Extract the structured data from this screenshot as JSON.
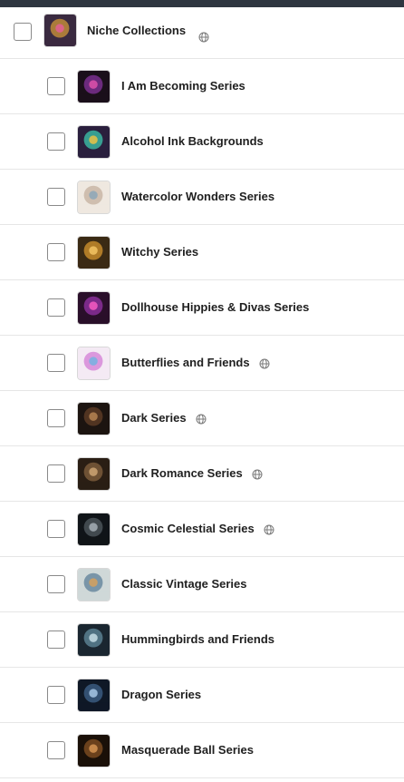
{
  "parent": {
    "label": "Niche Collections",
    "icon": "globe-icon"
  },
  "items": [
    {
      "label": "I Am Becoming Series",
      "globe": false,
      "thumb_colors": [
        "#1a0f1a",
        "#7a2f8f",
        "#d84fa8"
      ]
    },
    {
      "label": "Alcohol Ink Backgrounds",
      "globe": false,
      "thumb_colors": [
        "#2a1f3d",
        "#3bb5a0",
        "#e0c04a"
      ]
    },
    {
      "label": "Watercolor Wonders Series",
      "globe": false,
      "thumb_colors": [
        "#efe8e0",
        "#c9b6a6",
        "#8fa7b8"
      ]
    },
    {
      "label": "Witchy Series",
      "globe": false,
      "thumb_colors": [
        "#3a2a14",
        "#c48a2a",
        "#f0c060"
      ]
    },
    {
      "label": "Dollhouse Hippies & Divas Series",
      "globe": false,
      "thumb_colors": [
        "#2a0f2a",
        "#8a2f9a",
        "#f058c0"
      ]
    },
    {
      "label": "Butterflies and Friends",
      "globe": true,
      "thumb_colors": [
        "#f4eaf4",
        "#d68ad8",
        "#7ab0e0"
      ]
    },
    {
      "label": "Dark Series",
      "globe": true,
      "thumb_colors": [
        "#1c1410",
        "#5a3a24",
        "#b08050"
      ]
    },
    {
      "label": "Dark Romance Series",
      "globe": true,
      "thumb_colors": [
        "#2a1e14",
        "#7a5a3a",
        "#c8a070"
      ]
    },
    {
      "label": "Cosmic Celestial Series",
      "globe": true,
      "thumb_colors": [
        "#101418",
        "#4a5258",
        "#a0a8b0"
      ]
    },
    {
      "label": "Classic Vintage Series",
      "globe": false,
      "thumb_colors": [
        "#cfd8d8",
        "#6a8aa0",
        "#d0a060"
      ]
    },
    {
      "label": "Hummingbirds and Friends",
      "globe": false,
      "thumb_colors": [
        "#1a2630",
        "#5a8090",
        "#c0d8e0"
      ]
    },
    {
      "label": "Dragon Series",
      "globe": false,
      "thumb_colors": [
        "#0f1826",
        "#3a5a80",
        "#a0c0e0"
      ]
    },
    {
      "label": "Masquerade Ball Series",
      "globe": false,
      "thumb_colors": [
        "#1a1008",
        "#7a4a20",
        "#d09050"
      ]
    }
  ],
  "parent_thumb_colors": [
    "#3a2a40",
    "#c08a3a",
    "#e06090"
  ]
}
